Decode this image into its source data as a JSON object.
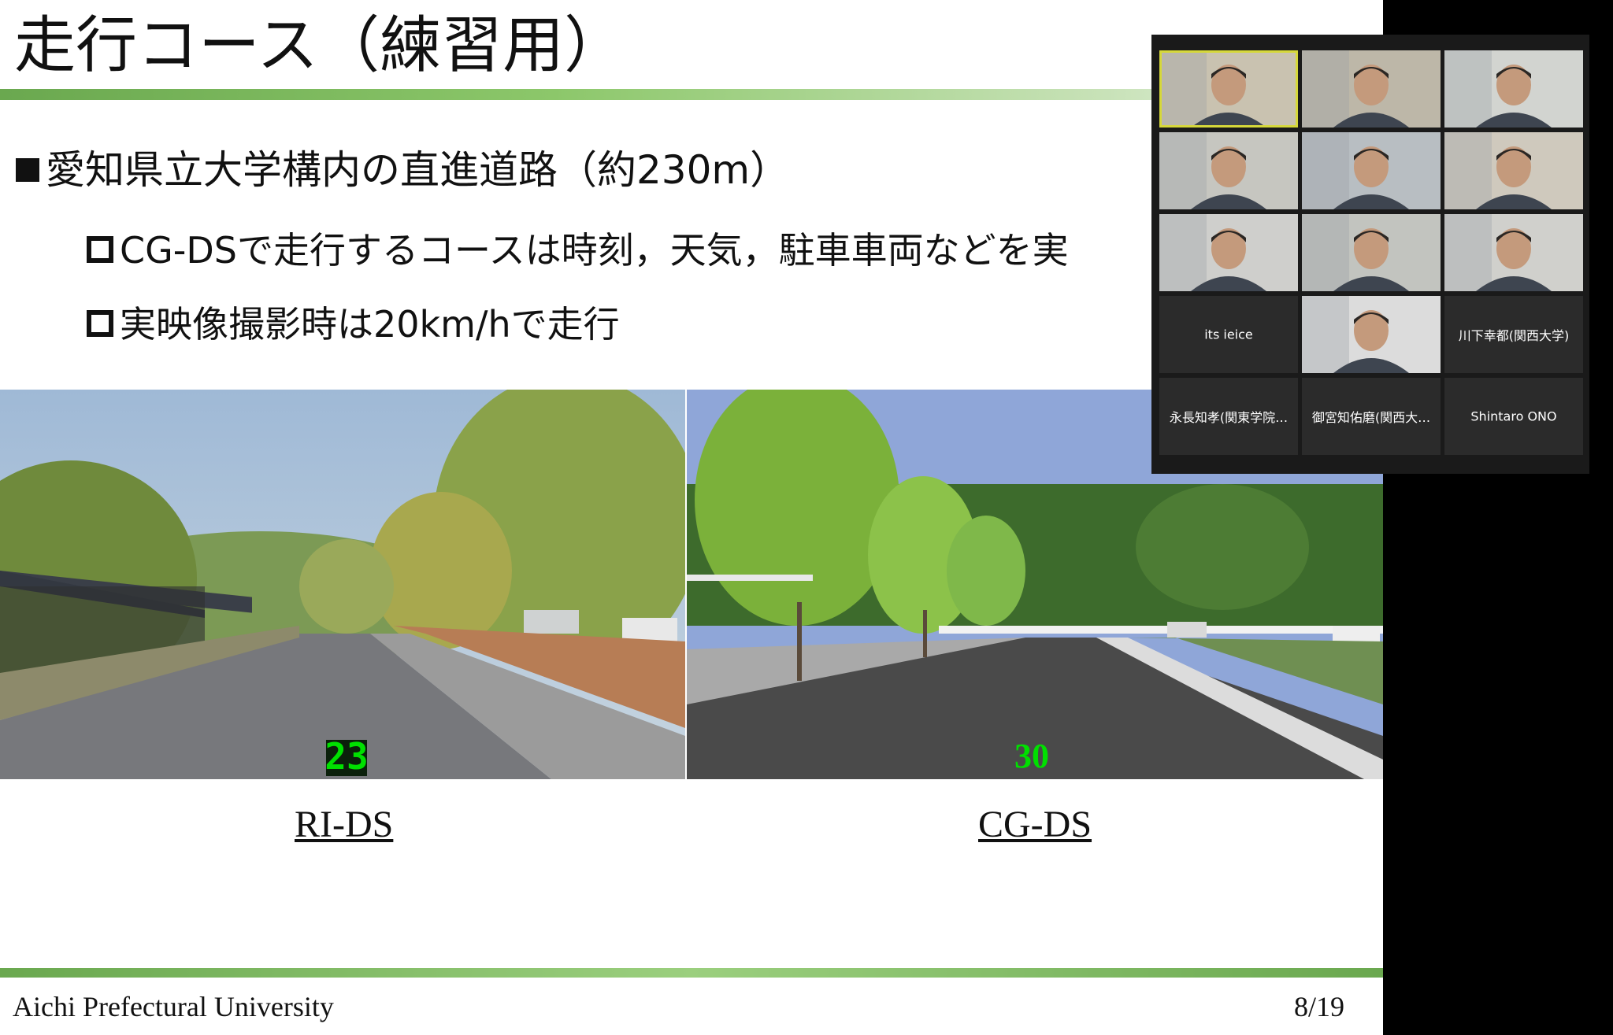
{
  "slide": {
    "title": "走行コース（練習用）",
    "bullet_main": "愛知県立大学構内の直進道路（約230m）",
    "bullet_sub1": "CG-DSで走行するコースは時刻，天気，駐車車両などを実",
    "bullet_sub2": "実映像撮影時は20km/hで走行",
    "caption_left": "RI-DS",
    "caption_right": "CG-DS",
    "speed_left": "23",
    "speed_right": "30",
    "footer_org": "Aichi Prefectural University",
    "page": "8/19"
  },
  "gallery": {
    "participants": [
      {
        "name": "",
        "video": true,
        "active": true
      },
      {
        "name": "",
        "video": true
      },
      {
        "name": "",
        "video": true
      },
      {
        "name": "",
        "video": true
      },
      {
        "name": "",
        "video": true
      },
      {
        "name": "",
        "video": true
      },
      {
        "name": "",
        "video": true
      },
      {
        "name": "",
        "video": true
      },
      {
        "name": "",
        "video": true
      },
      {
        "name": "its ieice",
        "video": false
      },
      {
        "name": "",
        "video": true
      },
      {
        "name": "川下幸都(関西大学)",
        "video": false
      },
      {
        "name": "永長知孝(関東学院…",
        "video": false
      },
      {
        "name": "御宮知佑磨(関西大…",
        "video": false
      },
      {
        "name": "Shintaro ONO",
        "video": false
      }
    ]
  },
  "colors": {
    "accent_green": "#6aa84f",
    "speed_digits": "#00e000",
    "active_speaker": "#d6d83a"
  }
}
